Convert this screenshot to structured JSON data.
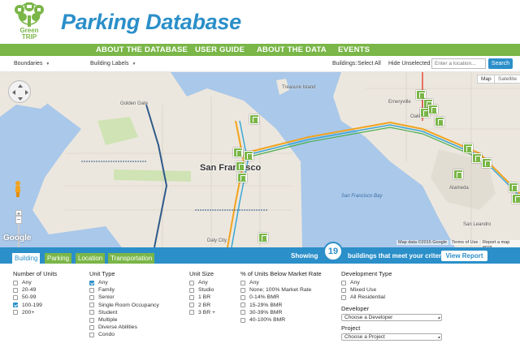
{
  "header": {
    "logo_text_top": "Green",
    "logo_text_bottom": "TRIP",
    "title": "Parking Database",
    "brand_color": "#7ab648",
    "accent_color": "#2b8fc9"
  },
  "nav": {
    "items": [
      "ABOUT THE DATABASE",
      "USER GUIDE",
      "ABOUT THE DATA",
      "EVENTS"
    ]
  },
  "toolbar": {
    "boundaries": "Boundaries",
    "building_labels": "Building Labels",
    "buildings_label": "Buildings:",
    "select_all": "Select All",
    "hide_unselected": "Hide Unselected",
    "location_placeholder": "Enter a location...",
    "search": "Search"
  },
  "map": {
    "type_map": "Map",
    "type_satellite": "Satellite",
    "city": "San Francisco",
    "places": [
      "Treasure Island",
      "Emeryville",
      "Oakland",
      "Alameda",
      "Golden Gate",
      "Daly City",
      "San Leandro"
    ],
    "water": [
      "San Francisco Bay"
    ],
    "attribution": "Google",
    "map_data": "Map data ©2015 Google",
    "terms": "Terms of Use",
    "report": "Report a map error",
    "zoom_in": "+",
    "zoom_out": "−"
  },
  "tabs": {
    "items": [
      "Building",
      "Parking",
      "Location",
      "Transportation"
    ],
    "active": "Building",
    "showing": "Showing",
    "count": "19",
    "meet_text": "buildings that meet your criteria.",
    "view_report": "View Report"
  },
  "filters": {
    "units": {
      "title": "Number of Units",
      "options": [
        "Any",
        "20-49",
        "50-99",
        "100-199",
        "200+"
      ],
      "checked": [
        3
      ]
    },
    "unit_type": {
      "title": "Unit Type",
      "options": [
        "Any",
        "Family",
        "Senior",
        "Single Room Occupancy",
        "Student",
        "Multiple",
        "Diverse Abilities",
        "Condo"
      ],
      "checked": [
        0
      ]
    },
    "unit_size": {
      "title": "Unit Size",
      "options": [
        "Any",
        "Studio",
        "1 BR",
        "2 BR",
        "3 BR +"
      ],
      "checked": []
    },
    "bmr": {
      "title": "% of Units Below Market Rate",
      "options": [
        "Any",
        "None; 100% Market Rate",
        "0-14% BMR",
        "15-29% BMR",
        "30-39% BMR",
        "40-100% BMR"
      ],
      "checked": []
    },
    "dev_type": {
      "title": "Development Type",
      "options": [
        "Any",
        "Mixed Use",
        "All Residential"
      ],
      "checked": []
    },
    "developer": {
      "title": "Developer",
      "placeholder": "Choose a Developer"
    },
    "project": {
      "title": "Project",
      "placeholder": "Choose a Project"
    }
  }
}
